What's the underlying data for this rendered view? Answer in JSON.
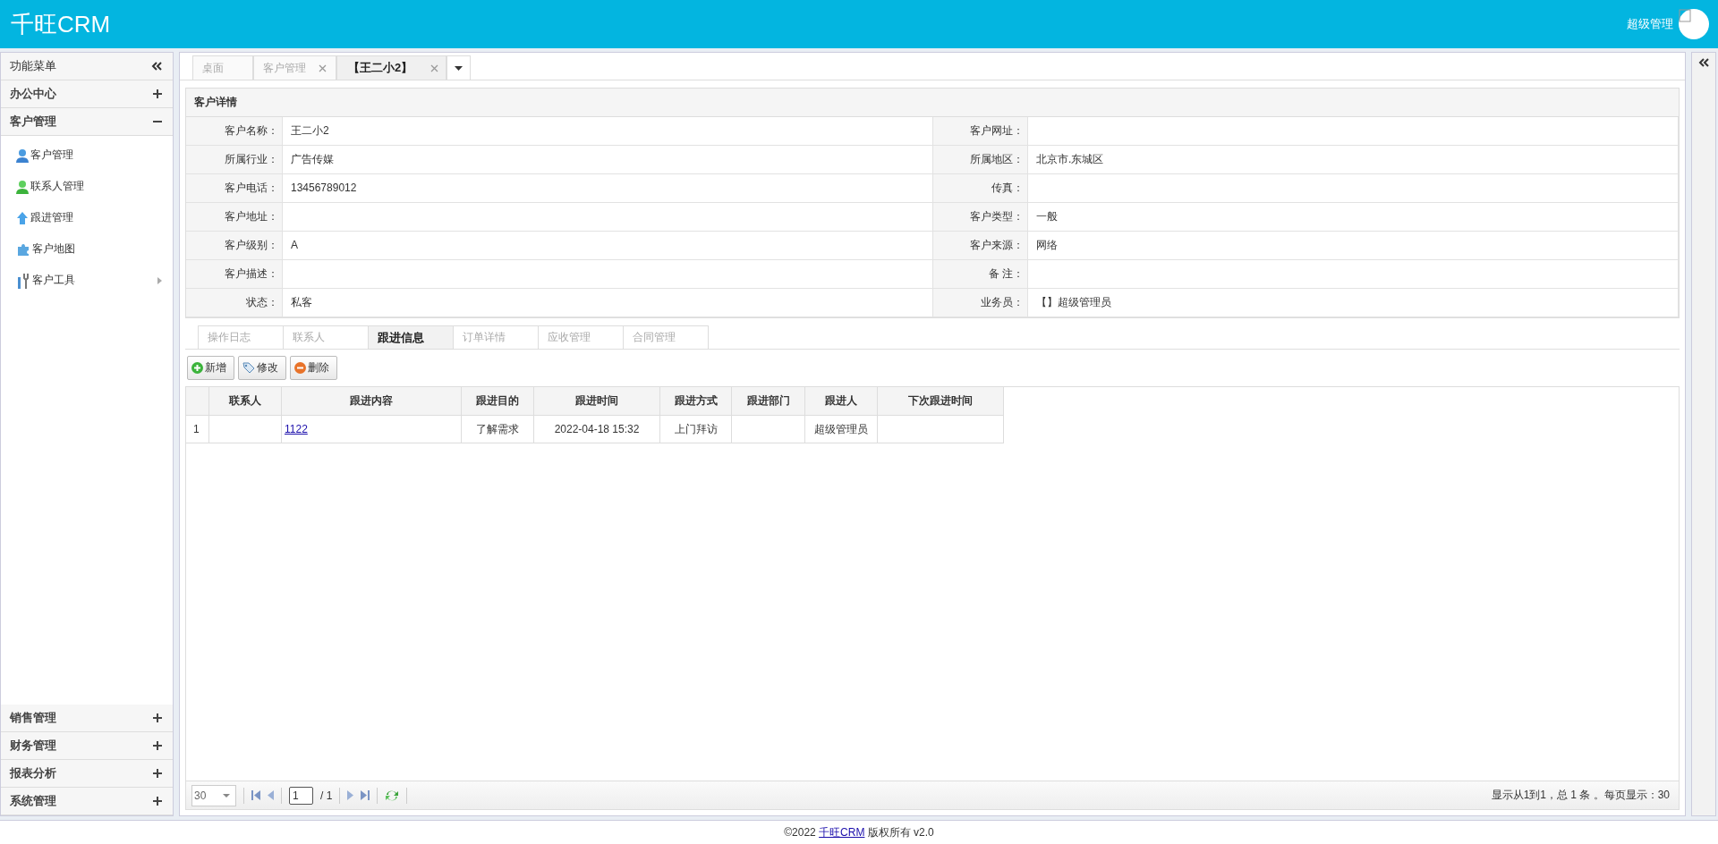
{
  "header": {
    "title": "千旺CRM",
    "user": "超级管理"
  },
  "sidebar": {
    "title": "功能菜单",
    "groups": [
      {
        "label": "办公中心",
        "expanded": false
      },
      {
        "label": "客户管理",
        "expanded": true,
        "children": [
          {
            "label": "客户管理",
            "kind": "customer",
            "has_submenu": false
          },
          {
            "label": "联系人管理",
            "kind": "contact",
            "has_submenu": false
          },
          {
            "label": "跟进管理",
            "kind": "followup",
            "has_submenu": false
          },
          {
            "label": "客户地图",
            "kind": "map",
            "has_submenu": false
          },
          {
            "label": "客户工具",
            "kind": "tools",
            "has_submenu": true
          }
        ]
      },
      {
        "label": "销售管理",
        "expanded": false
      },
      {
        "label": "财务管理",
        "expanded": false
      },
      {
        "label": "报表分析",
        "expanded": false
      },
      {
        "label": "系统管理",
        "expanded": false
      }
    ]
  },
  "tabs": [
    {
      "label": "桌面",
      "closable": false,
      "selected": false
    },
    {
      "label": "客户管理",
      "closable": true,
      "selected": false
    },
    {
      "label": "【王二小2】",
      "closable": true,
      "selected": true
    }
  ],
  "detail": {
    "title": "客户详情",
    "fields": [
      {
        "label": "客户名称：",
        "value": "王二小2"
      },
      {
        "label": "客户网址："
      },
      {
        "label": "所属行业：",
        "value": "广告传媒"
      },
      {
        "label": "所属地区：",
        "value": "北京市.东城区"
      },
      {
        "label": "客户电话：",
        "value": "13456789012"
      },
      {
        "label": "传真："
      },
      {
        "label": "客户地址："
      },
      {
        "label": "客户类型：",
        "value": "一般"
      },
      {
        "label": "客户级别：",
        "value": "A"
      },
      {
        "label": "客户来源：",
        "value": "网络"
      },
      {
        "label": "客户描述："
      },
      {
        "label": "备 注："
      },
      {
        "label": "状态：",
        "value": "私客"
      },
      {
        "label": "业务员：",
        "value": "【】超级管理员"
      }
    ]
  },
  "sub_tabs": [
    {
      "label": "操作日志",
      "selected": false
    },
    {
      "label": "联系人",
      "selected": false
    },
    {
      "label": "跟进信息",
      "selected": true
    },
    {
      "label": "订单详情",
      "selected": false
    },
    {
      "label": "应收管理",
      "selected": false
    },
    {
      "label": "合同管理",
      "selected": false
    }
  ],
  "toolbar": [
    {
      "label": "新增",
      "kind": "add"
    },
    {
      "label": "修改",
      "kind": "edit"
    },
    {
      "label": "删除",
      "kind": "delete"
    }
  ],
  "table": {
    "columns": [
      {
        "label": "联系人"
      },
      {
        "label": "跟进内容",
        "kind": "link"
      },
      {
        "label": "跟进目的"
      },
      {
        "label": "跟进时间"
      },
      {
        "label": "跟进方式"
      },
      {
        "label": "跟进部门"
      },
      {
        "label": "跟进人"
      },
      {
        "label": "下次跟进时间"
      }
    ],
    "rows": [
      {
        "row_number": "1",
        "cells": [
          null,
          "1122",
          "了解需求",
          "2022-04-18 15:32",
          "上门拜访",
          null,
          "超级管理员",
          null
        ]
      }
    ]
  },
  "pager": {
    "page_size": "30",
    "page": "1",
    "total_pages": "/ 1",
    "summary": "显示从1到1，总 1 条 。每页显示：30"
  },
  "footer": {
    "prefix": "©2022",
    "link": "千旺CRM",
    "suffix": "版权所有 v2.0"
  }
}
